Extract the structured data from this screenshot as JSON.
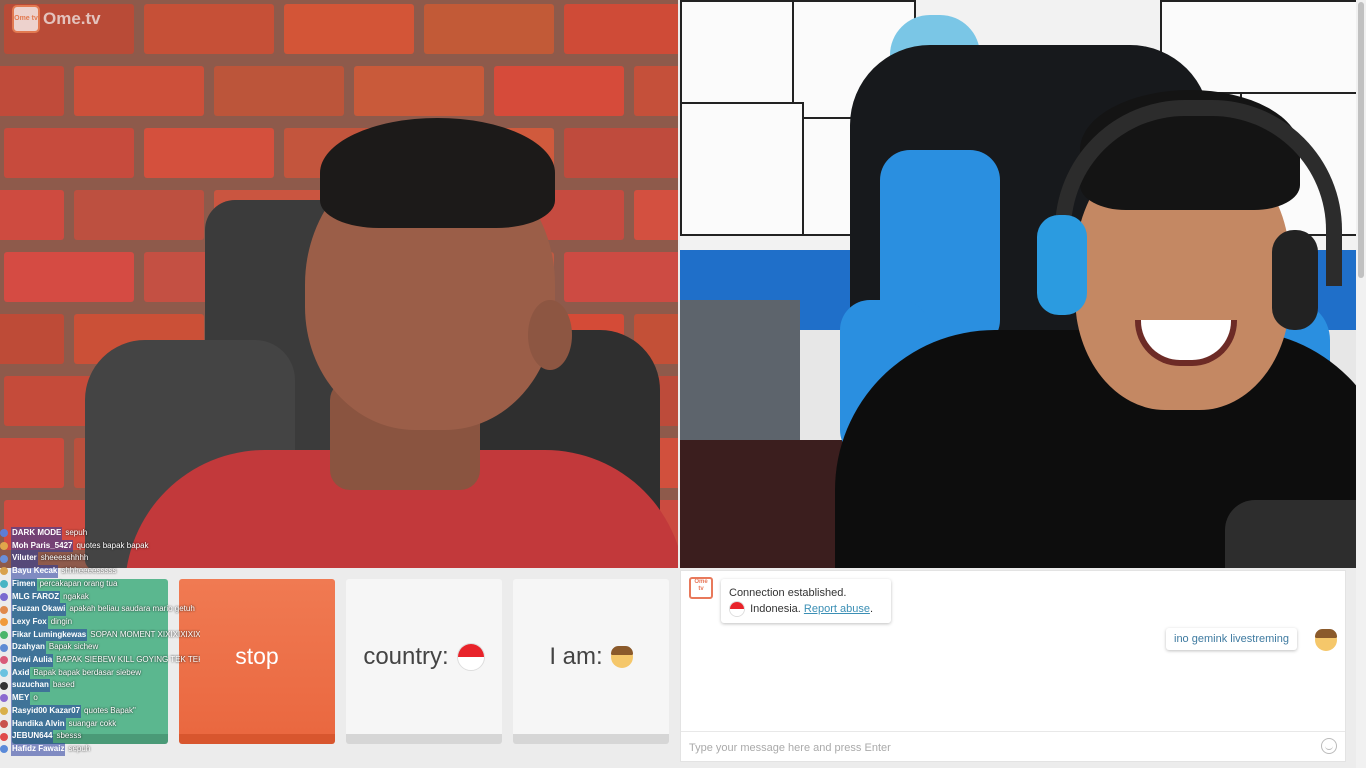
{
  "app": {
    "logo_icon_text": "Ome tv",
    "logo_text": "Ome.tv"
  },
  "controls": {
    "new_label": "",
    "stop_label": "stop",
    "country_label": "country:",
    "country_flag": "indonesia-flag",
    "iam_label": "I am:",
    "iam_icon": "man-emoji"
  },
  "stream_chat": [
    {
      "name": "DARK MODE",
      "msg": "sepuh",
      "color": "#5d7dd6"
    },
    {
      "name": "Moh Paris_5427",
      "msg": "quotes bapak bapak",
      "color": "#e0a64b"
    },
    {
      "name": "Viluter",
      "msg": "sheeesshhhh",
      "color": "#6a8fd9"
    },
    {
      "name": "Bayu Kecak",
      "msg": "shhheeeesssss",
      "color": "#d9a24d"
    },
    {
      "name": "Fimen",
      "msg": "percakapan orang tua",
      "color": "#48b5c4"
    },
    {
      "name": "MLG FAROZ",
      "msg": "ngakak",
      "color": "#7a6ad0"
    },
    {
      "name": "Fauzan Okawi",
      "msg": "apakah beliau saudara mario getuh",
      "color": "#e08a4d"
    },
    {
      "name": "Lexy Fox",
      "msg": "dingin",
      "color": "#f09a3a"
    },
    {
      "name": "Fikar Lumingkewas",
      "msg": "SOPAN MOMENT XIXIXIXIXIXI",
      "color": "#4bb56a"
    },
    {
      "name": "Dzahyan",
      "msg": "Bapak sichew",
      "color": "#5e8bd4"
    },
    {
      "name": "Dewi Aulia",
      "msg": "BAPAK SIEBEW KILL GOYING TEK TEK",
      "color": "#d95a7a"
    },
    {
      "name": "Axid",
      "msg": "Bapak bapak berdasar siebew",
      "color": "#6ac2e0"
    },
    {
      "name": "suzuchan",
      "msg": "based",
      "color": "#333333"
    },
    {
      "name": "MEY",
      "msg": "o",
      "color": "#8b6ad0"
    },
    {
      "name": "Rasyid00 Kazar07",
      "msg": "quotes Bapak\"",
      "color": "#d9b04b"
    },
    {
      "name": "Handika Alvin",
      "msg": "suangar cokk",
      "color": "#c9524d"
    },
    {
      "name": "JEBUN644",
      "msg": "sbesss",
      "color": "#e04a4a"
    },
    {
      "name": "Hafidz Fawaiz",
      "msg": "sepuh",
      "color": "#5a8ad9"
    }
  ],
  "chat": {
    "system_icon_text": "Ome tv",
    "connection_text": "Connection established.",
    "country_name": "Indonesia.",
    "report_link": "Report abuse",
    "report_after": ".",
    "user_message": "ino gemink livestreming",
    "input_placeholder": "Type your message here and press Enter",
    "input_value": ""
  },
  "colors": {
    "stop": "#ea6840",
    "new": "#5bb78f",
    "link": "#3b8fb5"
  }
}
